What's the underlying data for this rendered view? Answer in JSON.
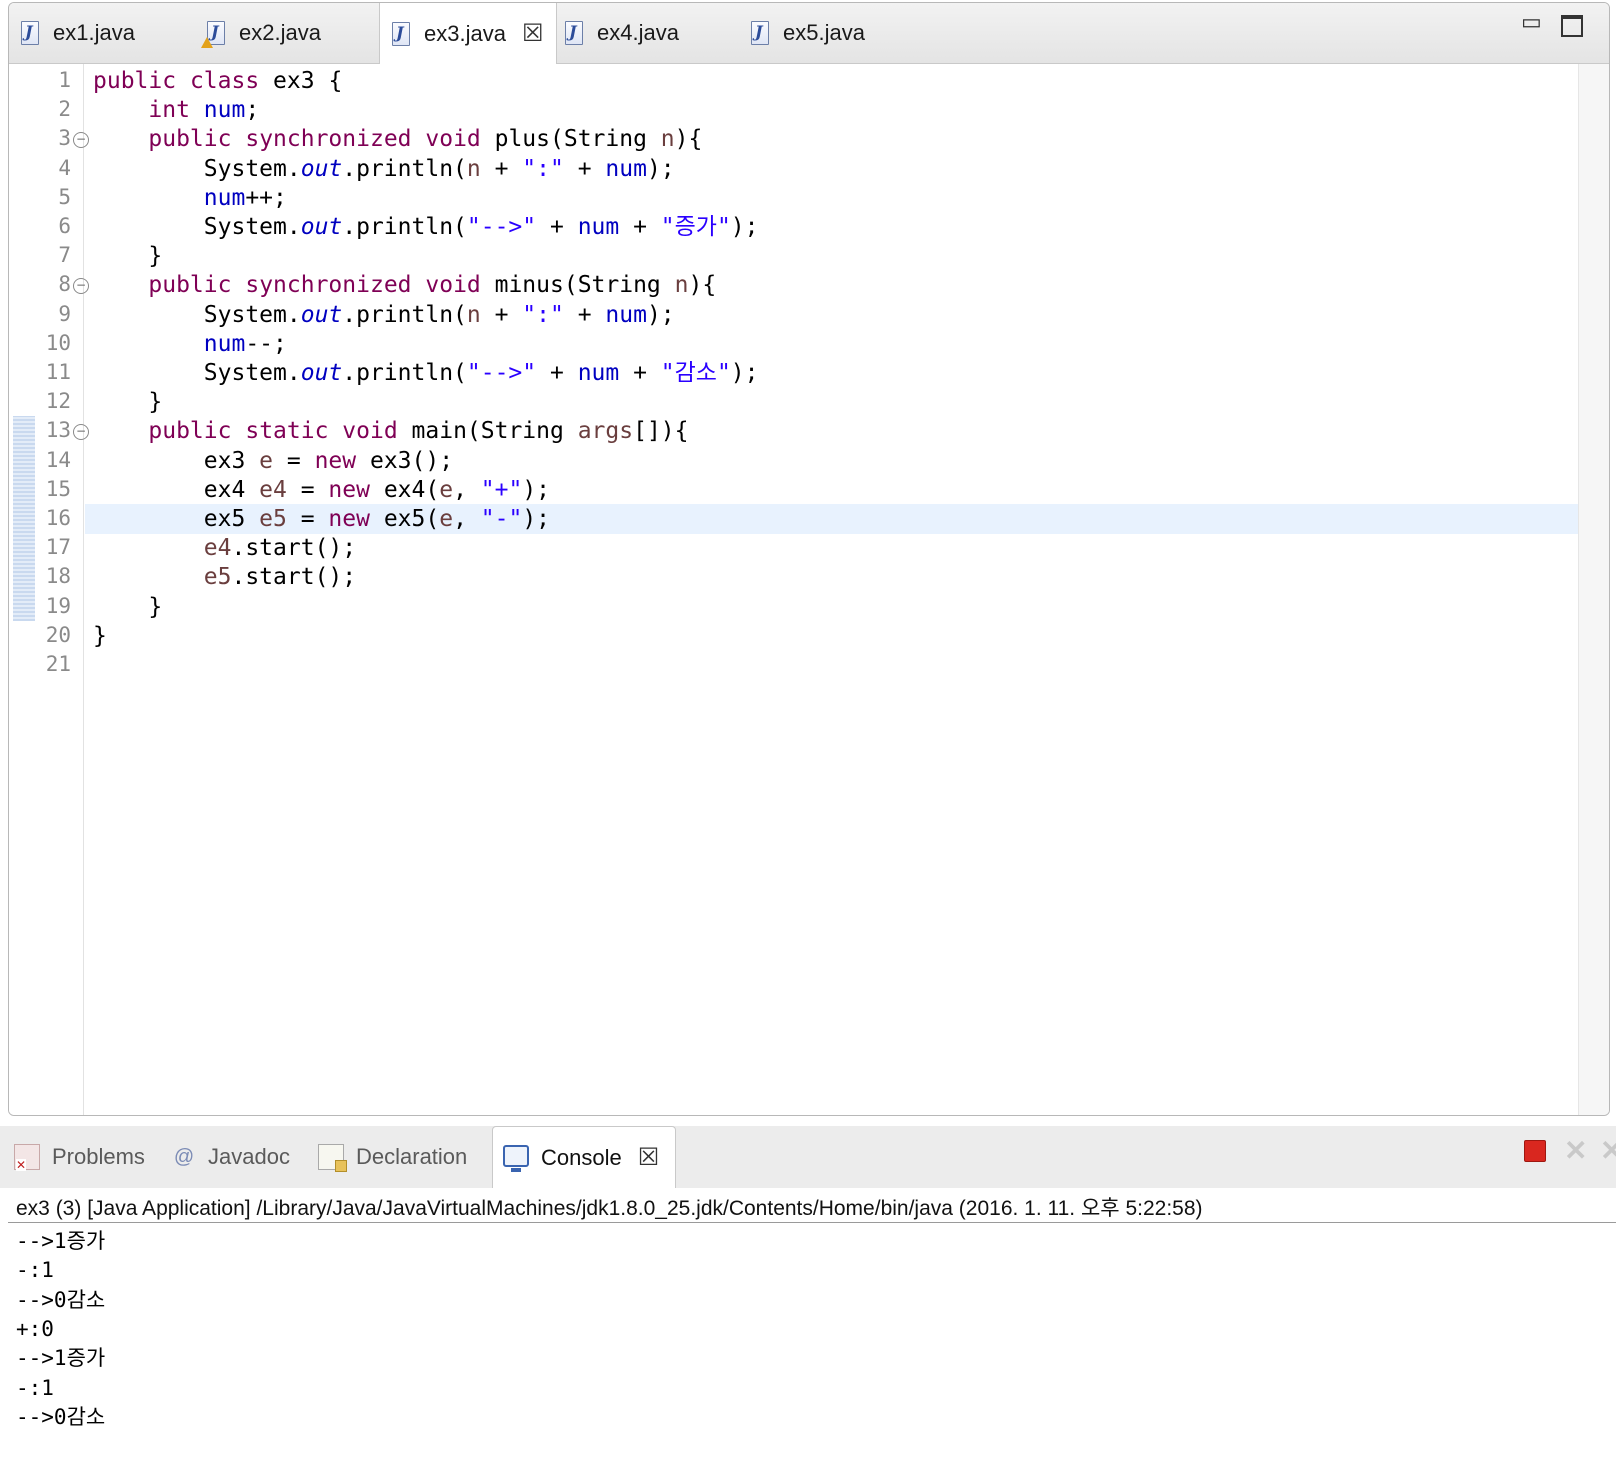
{
  "editor": {
    "tabs": [
      {
        "label": "ex1.java",
        "warning": false,
        "active": false
      },
      {
        "label": "ex2.java",
        "warning": true,
        "active": false
      },
      {
        "label": "ex3.java",
        "warning": false,
        "active": true
      },
      {
        "label": "ex4.java",
        "warning": false,
        "active": false
      },
      {
        "label": "ex5.java",
        "warning": false,
        "active": false
      }
    ],
    "current_line": 16,
    "lines": [
      {
        "n": "1",
        "fold": false,
        "tokens": [
          [
            "kw",
            "public"
          ],
          [
            "p",
            " "
          ],
          [
            "kw",
            "class"
          ],
          [
            "p",
            " ex3 {"
          ]
        ]
      },
      {
        "n": "2",
        "fold": false,
        "tokens": [
          [
            "p",
            "    "
          ],
          [
            "kw",
            "int"
          ],
          [
            "p",
            " "
          ],
          [
            "fld",
            "num"
          ],
          [
            "p",
            ";"
          ]
        ]
      },
      {
        "n": "3",
        "fold": true,
        "tokens": [
          [
            "p",
            "    "
          ],
          [
            "kw",
            "public"
          ],
          [
            "p",
            " "
          ],
          [
            "kw",
            "synchronized"
          ],
          [
            "p",
            " "
          ],
          [
            "kw",
            "void"
          ],
          [
            "p",
            " plus(String "
          ],
          [
            "lv",
            "n"
          ],
          [
            "p",
            "){"
          ]
        ]
      },
      {
        "n": "4",
        "fold": false,
        "tokens": [
          [
            "p",
            "        System."
          ],
          [
            "it",
            "out"
          ],
          [
            "p",
            ".println("
          ],
          [
            "lv",
            "n"
          ],
          [
            "p",
            " + "
          ],
          [
            "st",
            "\":\""
          ],
          [
            "p",
            " + "
          ],
          [
            "fld",
            "num"
          ],
          [
            "p",
            ");"
          ]
        ]
      },
      {
        "n": "5",
        "fold": false,
        "tokens": [
          [
            "p",
            "        "
          ],
          [
            "fld",
            "num"
          ],
          [
            "p",
            "++;"
          ]
        ]
      },
      {
        "n": "6",
        "fold": false,
        "tokens": [
          [
            "p",
            "        System."
          ],
          [
            "it",
            "out"
          ],
          [
            "p",
            ".println("
          ],
          [
            "st",
            "\"-->\""
          ],
          [
            "p",
            " + "
          ],
          [
            "fld",
            "num"
          ],
          [
            "p",
            " + "
          ],
          [
            "st",
            "\"증가\""
          ],
          [
            "p",
            ");"
          ]
        ]
      },
      {
        "n": "7",
        "fold": false,
        "tokens": [
          [
            "p",
            "    }"
          ]
        ]
      },
      {
        "n": "8",
        "fold": true,
        "tokens": [
          [
            "p",
            "    "
          ],
          [
            "kw",
            "public"
          ],
          [
            "p",
            " "
          ],
          [
            "kw",
            "synchronized"
          ],
          [
            "p",
            " "
          ],
          [
            "kw",
            "void"
          ],
          [
            "p",
            " minus(String "
          ],
          [
            "lv",
            "n"
          ],
          [
            "p",
            "){"
          ]
        ]
      },
      {
        "n": "9",
        "fold": false,
        "tokens": [
          [
            "p",
            "        System."
          ],
          [
            "it",
            "out"
          ],
          [
            "p",
            ".println("
          ],
          [
            "lv",
            "n"
          ],
          [
            "p",
            " + "
          ],
          [
            "st",
            "\":\""
          ],
          [
            "p",
            " + "
          ],
          [
            "fld",
            "num"
          ],
          [
            "p",
            ");"
          ]
        ]
      },
      {
        "n": "10",
        "fold": false,
        "tokens": [
          [
            "p",
            "        "
          ],
          [
            "fld",
            "num"
          ],
          [
            "p",
            "--;"
          ]
        ]
      },
      {
        "n": "11",
        "fold": false,
        "tokens": [
          [
            "p",
            "        System."
          ],
          [
            "it",
            "out"
          ],
          [
            "p",
            ".println("
          ],
          [
            "st",
            "\"-->\""
          ],
          [
            "p",
            " + "
          ],
          [
            "fld",
            "num"
          ],
          [
            "p",
            " + "
          ],
          [
            "st",
            "\"감소\""
          ],
          [
            "p",
            ");"
          ]
        ]
      },
      {
        "n": "12",
        "fold": false,
        "tokens": [
          [
            "p",
            "    }"
          ]
        ]
      },
      {
        "n": "13",
        "fold": true,
        "tokens": [
          [
            "p",
            "    "
          ],
          [
            "kw",
            "public"
          ],
          [
            "p",
            " "
          ],
          [
            "kw",
            "static"
          ],
          [
            "p",
            " "
          ],
          [
            "kw",
            "void"
          ],
          [
            "p",
            " main(String "
          ],
          [
            "lv",
            "args"
          ],
          [
            "p",
            "[]){"
          ]
        ]
      },
      {
        "n": "14",
        "fold": false,
        "tokens": [
          [
            "p",
            "        ex3 "
          ],
          [
            "lv",
            "e"
          ],
          [
            "p",
            " = "
          ],
          [
            "kw",
            "new"
          ],
          [
            "p",
            " ex3();"
          ]
        ]
      },
      {
        "n": "15",
        "fold": false,
        "tokens": [
          [
            "p",
            "        ex4 "
          ],
          [
            "lv",
            "e4"
          ],
          [
            "p",
            " = "
          ],
          [
            "kw",
            "new"
          ],
          [
            "p",
            " ex4("
          ],
          [
            "lv",
            "e"
          ],
          [
            "p",
            ", "
          ],
          [
            "st",
            "\"+\""
          ],
          [
            "p",
            ");"
          ]
        ]
      },
      {
        "n": "16",
        "fold": false,
        "tokens": [
          [
            "p",
            "        ex5 "
          ],
          [
            "lv",
            "e5"
          ],
          [
            "p",
            " = "
          ],
          [
            "kw",
            "new"
          ],
          [
            "p",
            " ex5("
          ],
          [
            "lv",
            "e"
          ],
          [
            "p",
            ", "
          ],
          [
            "st",
            "\"-\""
          ],
          [
            "p",
            ");"
          ]
        ]
      },
      {
        "n": "17",
        "fold": false,
        "tokens": [
          [
            "p",
            "        "
          ],
          [
            "lv",
            "e4"
          ],
          [
            "p",
            ".start();"
          ]
        ]
      },
      {
        "n": "18",
        "fold": false,
        "tokens": [
          [
            "p",
            "        "
          ],
          [
            "lv",
            "e5"
          ],
          [
            "p",
            ".start();"
          ]
        ]
      },
      {
        "n": "19",
        "fold": false,
        "tokens": [
          [
            "p",
            "    }"
          ]
        ]
      },
      {
        "n": "20",
        "fold": false,
        "tokens": [
          [
            "p",
            "}"
          ]
        ]
      },
      {
        "n": "21",
        "fold": false,
        "tokens": []
      }
    ]
  },
  "console": {
    "tabs": [
      {
        "label": "Problems",
        "icon": "problems-icon"
      },
      {
        "label": "Javadoc",
        "icon": "javadoc-icon"
      },
      {
        "label": "Declaration",
        "icon": "declaration-icon"
      },
      {
        "label": "Console",
        "icon": "console-icon",
        "active": true
      }
    ],
    "header": "ex3 (3) [Java Application] /Library/Java/JavaVirtualMachines/jdk1.8.0_25.jdk/Contents/Home/bin/java (2016. 1. 11. 오후 5:22:58)",
    "output": [
      "-->1증가",
      "-:1",
      "-->0감소",
      "+:0",
      "-->1증가",
      "-:1",
      "-->0감소"
    ]
  },
  "colors": {
    "keyword": "#7f0055",
    "field": "#0000c0",
    "string": "#2a00ff",
    "local": "#6a3e3e",
    "current_line": "#e8f2fe"
  }
}
